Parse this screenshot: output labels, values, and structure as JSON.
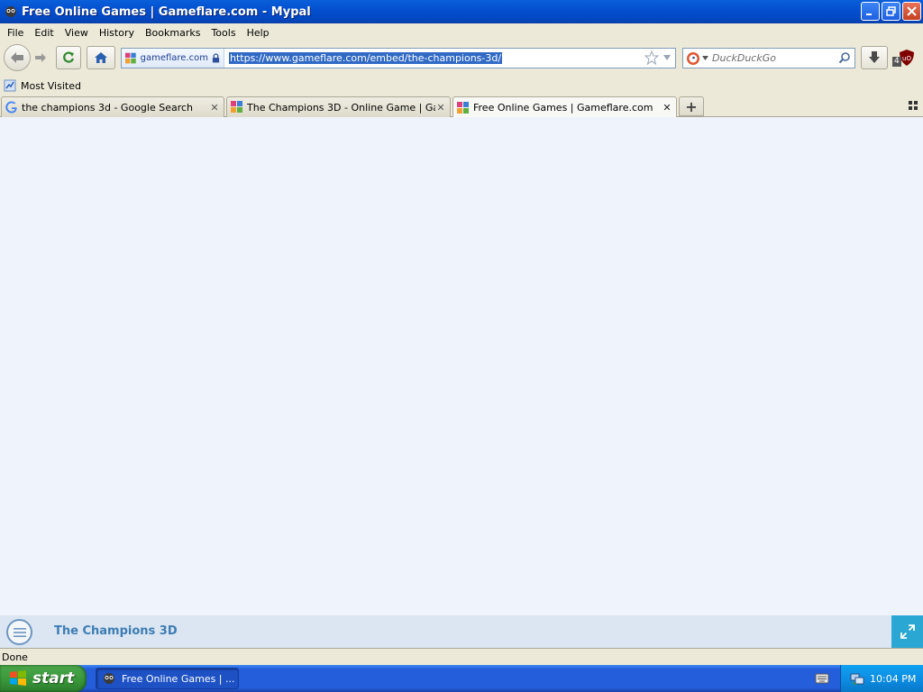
{
  "window": {
    "title": "Free Online Games | Gameflare.com - Mypal",
    "icon": "mypal-raccoon-icon"
  },
  "menubar": {
    "items": [
      "File",
      "Edit",
      "View",
      "History",
      "Bookmarks",
      "Tools",
      "Help"
    ]
  },
  "navbar": {
    "identity_label": "gameflare.com",
    "url": "https://www.gameflare.com/embed/the-champions-3d/",
    "search_placeholder": "DuckDuckGo",
    "addon_badge": "4"
  },
  "bookmarks": {
    "items": [
      "Most Visited"
    ]
  },
  "tabs": [
    {
      "label": "the champions 3d - Google Search",
      "icon": "google-icon",
      "active": false
    },
    {
      "label": "The Champions 3D - Online Game | Game...",
      "icon": "gameflare-icon",
      "active": false
    },
    {
      "label": "Free Online Games | Gameflare.com",
      "icon": "gameflare-icon",
      "active": true
    }
  ],
  "page": {
    "game_title": "The Champions 3D"
  },
  "status": {
    "text": "Done"
  },
  "taskbar": {
    "start_label": "start",
    "task_label": "Free Online Games | ...",
    "clock": "10:04 PM"
  },
  "colors": {
    "content_bg": "#eff3fc",
    "footer_bg": "#dbe6f2",
    "game_title": "#3d7cb2",
    "fullscreen_btn": "#2aa7d2"
  }
}
